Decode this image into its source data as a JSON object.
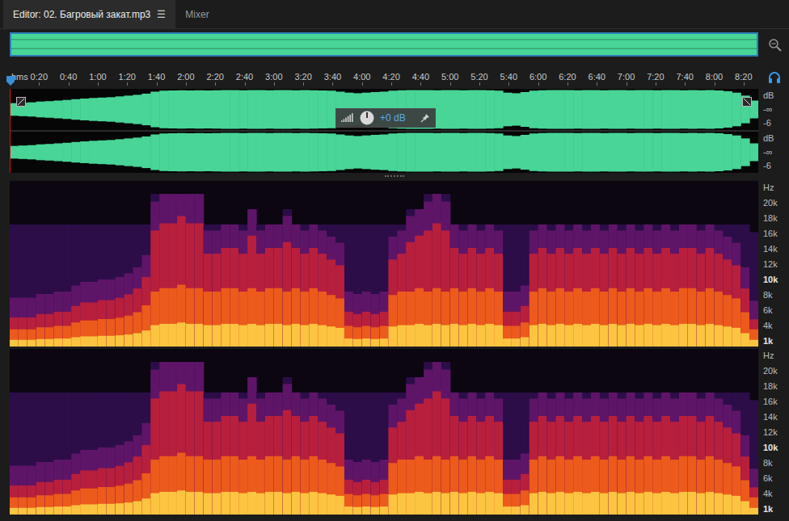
{
  "tabs": [
    {
      "label": "Editor: 02. Багровый закат.mp3",
      "menu": "☰",
      "selected": true
    },
    {
      "label": "Mixer",
      "selected": false
    }
  ],
  "ruler": {
    "unit": "hms",
    "ticks": [
      "0:20",
      "0:40",
      "1:00",
      "1:20",
      "1:40",
      "2:00",
      "2:20",
      "2:40",
      "3:00",
      "3:20",
      "3:40",
      "4:00",
      "4:20",
      "4:40",
      "5:00",
      "5:20",
      "5:40",
      "6:00",
      "6:20",
      "6:40",
      "7:00",
      "7:20",
      "7:40",
      "8:00",
      "8:20"
    ]
  },
  "hud": {
    "gain": "+0 dB"
  },
  "waveform": {
    "channels": [
      {
        "scale": [
          "dB",
          "-∞",
          "-6"
        ]
      },
      {
        "scale": [
          "dB",
          "-∞",
          "-6"
        ]
      }
    ],
    "envelope": [
      0.32,
      0.34,
      0.36,
      0.4,
      0.42,
      0.45,
      0.48,
      0.52,
      0.55,
      0.58,
      0.6,
      0.62,
      0.66,
      0.7,
      0.74,
      0.8,
      0.9,
      0.95,
      0.96,
      0.97,
      0.96,
      0.97,
      0.96,
      0.97,
      0.98,
      0.98,
      0.97,
      0.98,
      0.98,
      0.97,
      0.98,
      0.98,
      0.97,
      0.98,
      0.97,
      0.96,
      0.95,
      0.9,
      0.85,
      0.82,
      0.85,
      0.88,
      0.9,
      0.95,
      0.97,
      0.98,
      0.98,
      0.98,
      0.97,
      0.98,
      0.98,
      0.97,
      0.98,
      0.98,
      0.97,
      0.95,
      0.85,
      0.82,
      0.88,
      0.95,
      0.97,
      0.98,
      0.98,
      0.98,
      0.97,
      0.98,
      0.98,
      0.97,
      0.98,
      0.98,
      0.97,
      0.98,
      0.98,
      0.97,
      0.98,
      0.98,
      0.97,
      0.98,
      0.97,
      0.98,
      0.96,
      0.92,
      0.85,
      0.7,
      0.45
    ]
  },
  "spectrogram": {
    "channels": [
      {
        "scale": [
          "Hz",
          "20k",
          "18k",
          "16k",
          "14k",
          "12k",
          "10k",
          "8k",
          "6k",
          "4k",
          "1k"
        ]
      },
      {
        "scale": [
          "Hz",
          "20k",
          "18k",
          "16k",
          "14k",
          "12k",
          "10k",
          "8k",
          "6k",
          "4k",
          "1k"
        ]
      }
    ],
    "peak_khz": [
      16,
      16,
      16,
      16,
      16,
      16,
      16,
      16,
      16,
      16,
      16,
      16,
      16,
      16,
      16,
      16,
      20,
      20,
      20,
      20,
      20,
      20,
      16,
      16,
      16,
      16,
      16,
      18,
      16,
      16,
      16,
      18,
      16,
      16,
      16,
      16,
      16,
      16,
      16,
      16,
      16,
      16,
      16,
      16,
      16,
      18,
      18,
      20,
      20,
      20,
      16,
      16,
      16,
      16,
      16,
      16,
      16,
      16,
      16,
      16,
      16,
      16,
      16,
      16,
      16,
      16,
      16,
      16,
      16,
      16,
      16,
      16,
      16,
      16,
      16,
      16,
      16,
      16,
      16,
      16,
      16,
      16,
      16,
      16,
      15
    ],
    "energy": [
      0.25,
      0.25,
      0.25,
      0.28,
      0.28,
      0.3,
      0.3,
      0.35,
      0.38,
      0.38,
      0.4,
      0.4,
      0.42,
      0.45,
      0.5,
      0.6,
      0.8,
      0.85,
      0.85,
      0.9,
      0.85,
      0.85,
      0.8,
      0.8,
      0.85,
      0.85,
      0.8,
      0.85,
      0.8,
      0.85,
      0.85,
      0.8,
      0.85,
      0.8,
      0.85,
      0.8,
      0.75,
      0.7,
      0.3,
      0.28,
      0.3,
      0.28,
      0.3,
      0.75,
      0.8,
      0.8,
      0.85,
      0.8,
      0.85,
      0.8,
      0.85,
      0.8,
      0.85,
      0.8,
      0.85,
      0.8,
      0.3,
      0.3,
      0.35,
      0.8,
      0.85,
      0.8,
      0.85,
      0.8,
      0.85,
      0.8,
      0.85,
      0.8,
      0.85,
      0.8,
      0.85,
      0.8,
      0.85,
      0.8,
      0.85,
      0.8,
      0.85,
      0.85,
      0.8,
      0.85,
      0.8,
      0.75,
      0.7,
      0.5,
      0.25
    ]
  }
}
